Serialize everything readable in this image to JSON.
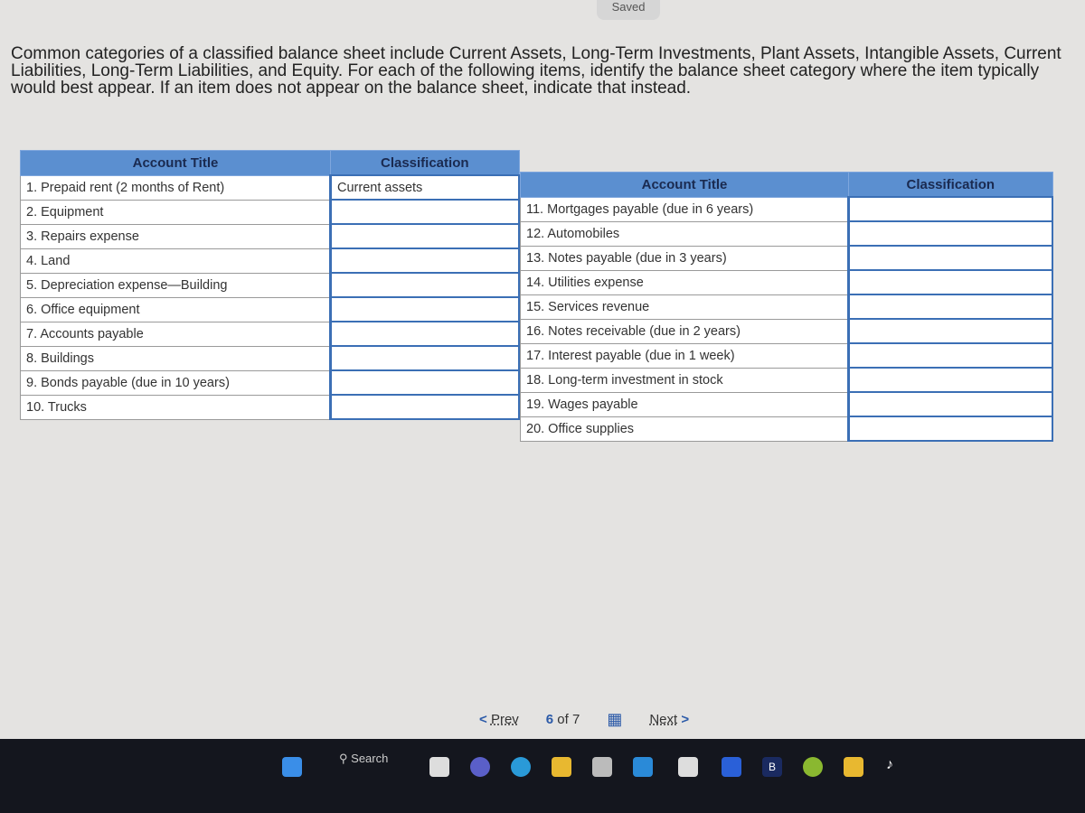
{
  "status": "Saved",
  "prompt": "Common categories of a classified balance sheet include Current Assets, Long-Term Investments, Plant Assets, Intangible Assets, Current Liabilities, Long-Term Liabilities, and Equity. For each of the following items, identify the balance sheet category where the item typically would best appear. If an item does not appear on the balance sheet, indicate that instead.",
  "headers": {
    "account_title": "Account Title",
    "classification": "Classification"
  },
  "left_rows": [
    {
      "title": "1. Prepaid rent (2 months of Rent)",
      "classification": "Current assets"
    },
    {
      "title": "2. Equipment",
      "classification": ""
    },
    {
      "title": "3. Repairs expense",
      "classification": ""
    },
    {
      "title": "4. Land",
      "classification": ""
    },
    {
      "title": "5. Depreciation expense—Building",
      "classification": ""
    },
    {
      "title": "6. Office equipment",
      "classification": ""
    },
    {
      "title": "7. Accounts payable",
      "classification": ""
    },
    {
      "title": "8. Buildings",
      "classification": ""
    },
    {
      "title": "9. Bonds payable (due in 10 years)",
      "classification": ""
    },
    {
      "title": "10. Trucks",
      "classification": ""
    }
  ],
  "right_rows": [
    {
      "title": "11. Mortgages payable (due in 6 years)",
      "classification": ""
    },
    {
      "title": "12. Automobiles",
      "classification": ""
    },
    {
      "title": "13. Notes payable (due in 3 years)",
      "classification": ""
    },
    {
      "title": "14. Utilities expense",
      "classification": ""
    },
    {
      "title": "15. Services revenue",
      "classification": ""
    },
    {
      "title": "16. Notes receivable (due in 2 years)",
      "classification": ""
    },
    {
      "title": "17. Interest payable (due in 1 week)",
      "classification": ""
    },
    {
      "title": "18. Long-term investment in stock",
      "classification": ""
    },
    {
      "title": "19. Wages payable",
      "classification": ""
    },
    {
      "title": "20. Office supplies",
      "classification": ""
    }
  ],
  "pager": {
    "prev": "Prev",
    "current": "6",
    "of": "of 7",
    "next": "Next"
  },
  "taskbar": {
    "search": "Search"
  },
  "colors": {
    "header": "#5b8fd0",
    "accent": "#2b5aa8"
  }
}
